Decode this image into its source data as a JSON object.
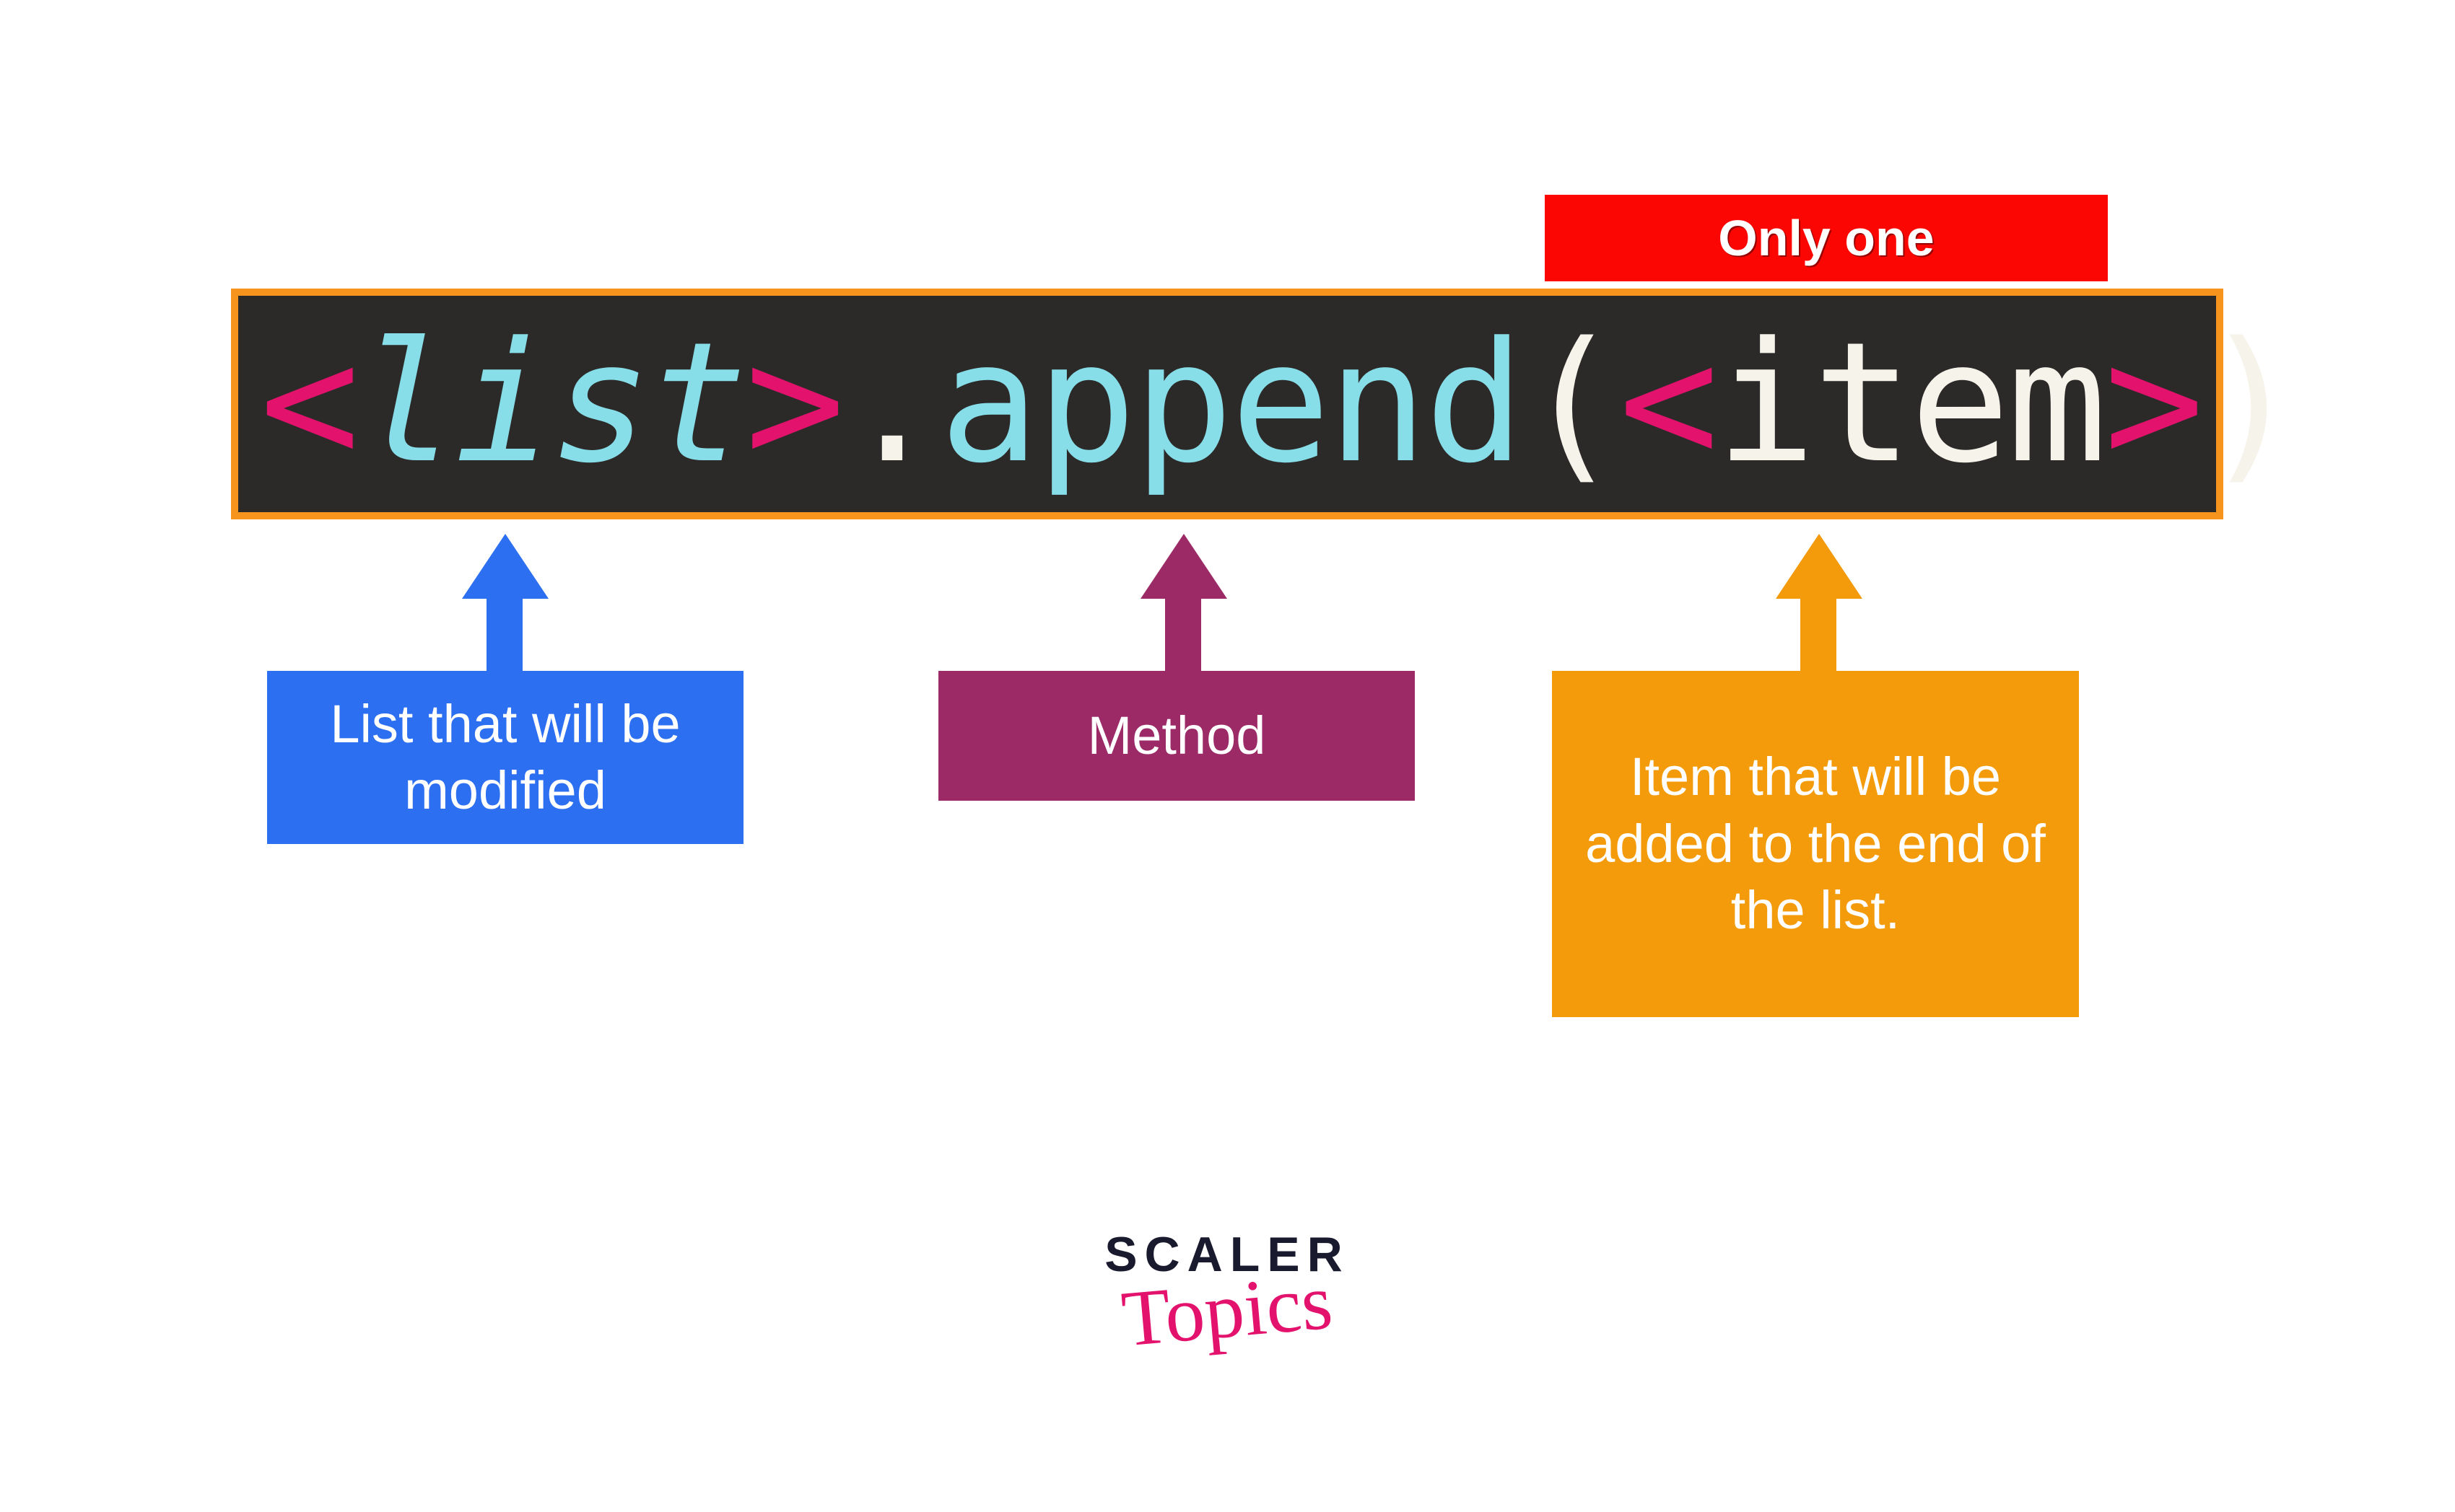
{
  "badge": {
    "only_one": "Only one"
  },
  "code": {
    "angle_open_1": "<",
    "list_ident": "list",
    "angle_close_1": ">",
    "dot": ".",
    "method": "append",
    "paren_open": "(",
    "angle_open_2": "<",
    "item_ident": "item",
    "angle_close_2": ">",
    "paren_close": ")"
  },
  "callouts": {
    "list": "List that will be modified",
    "method": "Method",
    "item": "Item that will be added to the end of the list."
  },
  "logo": {
    "line1": "SCALER",
    "line2": "Topics"
  },
  "colors": {
    "red": "#fb0603",
    "code_bg": "#2b2a28",
    "orange_border": "#f7941d",
    "angle": "#e2126d",
    "cyan": "#87dde8",
    "cream": "#f5f3ea",
    "blue": "#2d6ff1",
    "purple": "#9b2a67",
    "orange": "#f39b0b",
    "logo_dark": "#1a1a2e",
    "logo_pink": "#e2126d"
  }
}
